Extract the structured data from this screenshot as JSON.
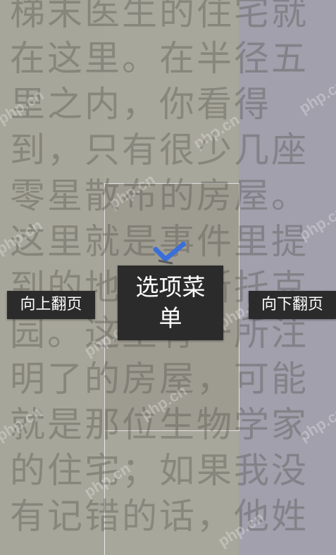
{
  "reader": {
    "book_lines": [
      "梯末医生的住宅就",
      "在这里。在半径五",
      "里之内，你看得",
      "到，只有很少几座",
      "零星散布的房屋。",
      "这里就是事件里提",
      "到的地方，斯托克",
      "园。这里有一所注",
      "明了的房屋，可能",
      "就是那位生物学家",
      "的住宅；如果我没",
      "有记错的话，他姓"
    ],
    "watermark_text": "php.cn"
  },
  "controls": {
    "prev_page_label": "向上翻页",
    "menu_label": "选项菜单",
    "next_page_label": "向下翻页"
  },
  "colors": {
    "button_bg": "#2b2b2b",
    "button_text": "#ffffff",
    "page_bg": "#a8a79b",
    "right_zone_bg": "#a2a0ac",
    "touch_icon": "#3a6fd8"
  },
  "icons": {
    "touch_hint": "tap-chevron-icon"
  }
}
